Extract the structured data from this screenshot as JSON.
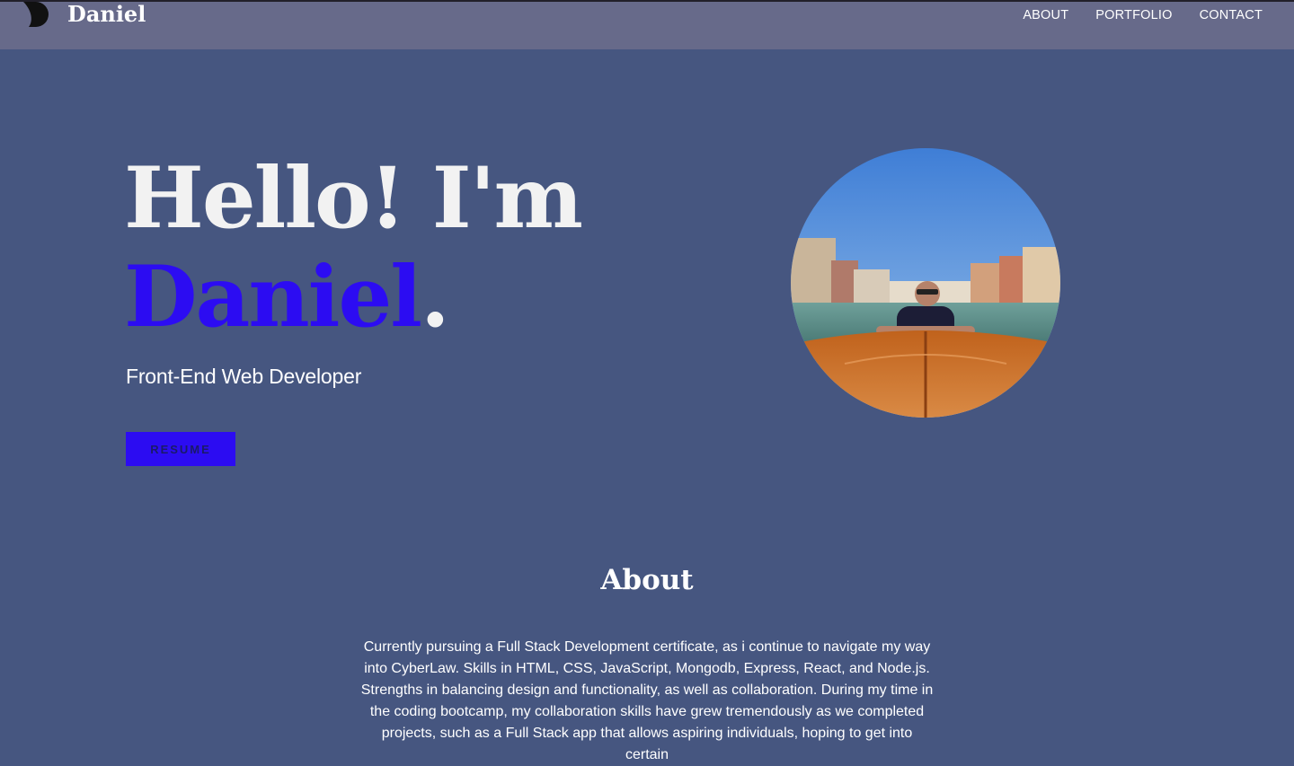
{
  "header": {
    "brand": "Daniel",
    "nav": [
      {
        "label": "ABOUT"
      },
      {
        "label": "PORTFOLIO"
      },
      {
        "label": "CONTACT"
      }
    ]
  },
  "hero": {
    "greeting": "Hello! I'm",
    "name": "Daniel",
    "punctuation": ".",
    "subtitle": "Front-End Web Developer",
    "resume_label": "RESUME"
  },
  "about": {
    "heading": "About",
    "body": "Currently pursuing a Full Stack Development certificate, as i continue to navigate my way into CyberLaw. Skills in HTML, CSS, JavaScript, Mongodb, Express, React, and Node.js. Strengths in balancing design and functionality, as well as collaboration. During my time in the coding bootcamp, my collaboration skills have grew tremendously as we completed projects, such as a Full Stack app that allows aspiring individuals, hoping to get into certain"
  },
  "colors": {
    "background": "#465680",
    "navbar": "#676a8a",
    "accent": "#2c0cf2",
    "text": "#f2f2f2"
  },
  "icons": {
    "logo": "d-logo-icon"
  }
}
